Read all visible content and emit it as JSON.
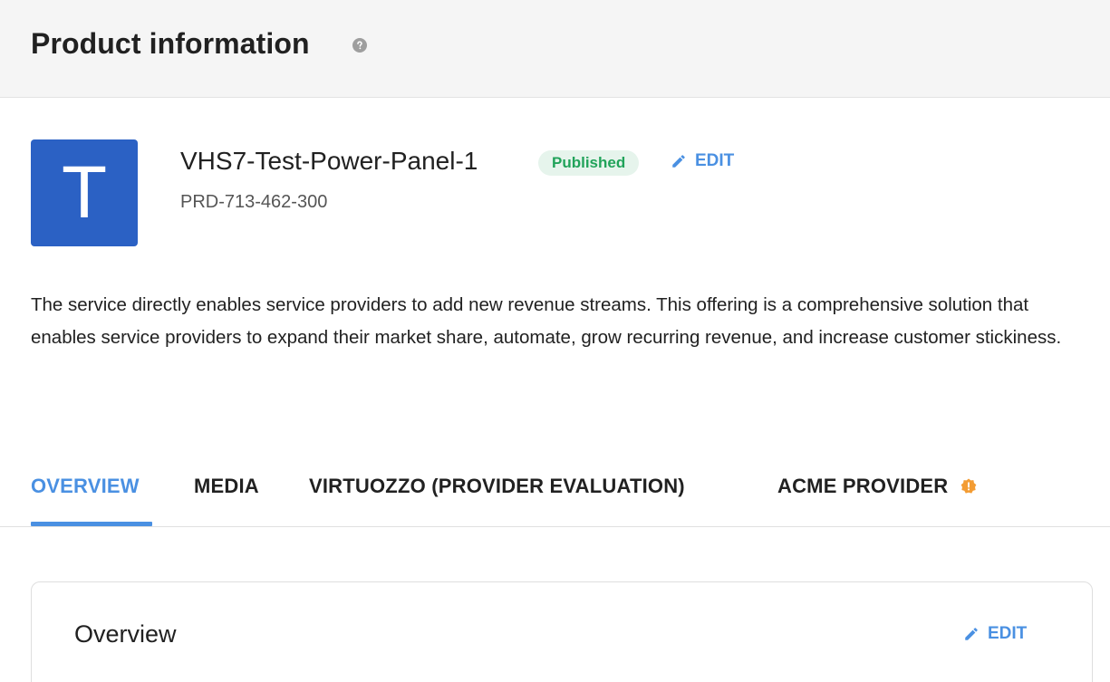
{
  "header": {
    "title": "Product information",
    "help_icon": "help-circle-icon"
  },
  "product": {
    "icon_letter": "T",
    "icon_color": "#2b61c4",
    "name": "VHS7-Test-Power-Panel-1",
    "status": "Published",
    "status_color": "#21a35a",
    "edit_label": "EDIT",
    "id": "PRD-713-462-300",
    "description": "The service directly enables service providers to add new revenue streams. This offering is a comprehensive solution that enables service providers to expand their market share, automate, grow recurring revenue, and increase customer stickiness."
  },
  "tabs": [
    {
      "label": "OVERVIEW",
      "active": true
    },
    {
      "label": "MEDIA",
      "active": false
    },
    {
      "label": "VIRTUOZZO (PROVIDER EVALUATION)",
      "active": false
    },
    {
      "label": "ACME PROVIDER",
      "active": false,
      "icon": "warning-badge-icon",
      "icon_color": "#f39c33"
    }
  ],
  "overview_card": {
    "title": "Overview",
    "edit_label": "EDIT"
  },
  "colors": {
    "accent": "#4a90e2",
    "header_bg": "#f5f5f5"
  }
}
